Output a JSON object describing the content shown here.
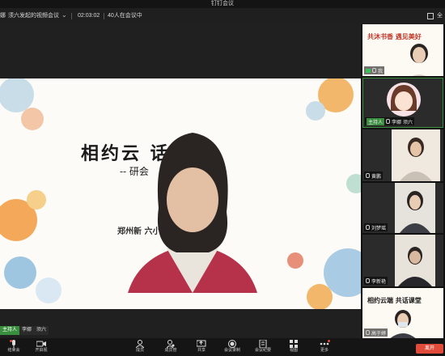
{
  "window": {
    "title": "钉钉会议"
  },
  "infobar": {
    "meeting_name": "须六发起的视频会议",
    "duration": "02:03:02",
    "participants": "40人在会议中",
    "fullscreen_label": "全"
  },
  "slide": {
    "title": "相约云        话课堂",
    "subtitle": "--                 研会",
    "school": "郑州新                 六小学"
  },
  "speaker": {
    "host_tag": "主持人",
    "name": "李娜",
    "role": "须六"
  },
  "gallery": [
    {
      "banner": "共沐书香 遇见美好",
      "caption": "我"
    },
    {
      "caption_tag": "主持人",
      "caption": "李娜",
      "extra": "须六"
    },
    {
      "caption": "黄鹏"
    },
    {
      "caption": "刘梦瑶"
    },
    {
      "caption": "李新艳"
    },
    {
      "banner": "相约云端 共话课堂",
      "caption": "高于婷"
    }
  ],
  "toolbar": {
    "items": [
      {
        "label": "结束会",
        "icon": "mic-icon"
      },
      {
        "label": "开启视",
        "icon": "camera-icon"
      },
      {
        "label": "成员",
        "icon": "members-icon"
      },
      {
        "label": "成员管",
        "icon": "members-manage-icon"
      },
      {
        "label": "共享",
        "icon": "share-screen-icon"
      },
      {
        "label": "会议录制",
        "icon": "record-icon"
      },
      {
        "label": "会议纪要",
        "icon": "minutes-icon"
      },
      {
        "label": "视图",
        "icon": "view-icon"
      },
      {
        "label": "更多",
        "icon": "more-icon"
      }
    ],
    "leave_label": "离开"
  },
  "colors": {
    "accent_green": "#3a8f3f",
    "leave_red": "#e04b3a"
  }
}
